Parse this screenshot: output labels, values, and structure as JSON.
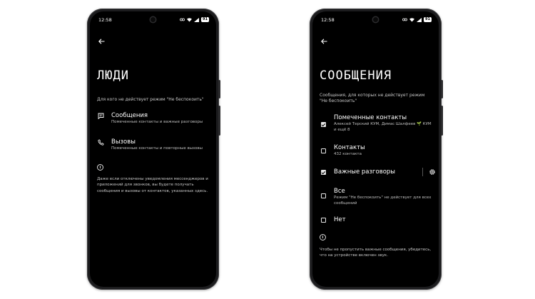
{
  "left_phone": {
    "status": {
      "time": "12:58",
      "battery": "91"
    },
    "title": "ЛЮДИ",
    "subtitle": "Для кого не действует режим \"Не беспокоить\"",
    "items": [
      {
        "title": "Сообщения",
        "subtitle": "Помеченные контакты и важные разговоры",
        "icon": "message-icon"
      },
      {
        "title": "Вызовы",
        "subtitle": "Помеченные контакты и повторные вызовы",
        "icon": "phone-icon"
      }
    ],
    "note": "Даже если отключены уведомления мессенджеров и приложений для звонков, вы будете получать сообщения и вызовы от контактов, указанных здесь."
  },
  "right_phone": {
    "status": {
      "time": "12:58",
      "battery": "91"
    },
    "title": "СООБЩЕНИЯ",
    "subtitle": "Сообщения, для которых не действует режим \"Не беспокоить\"",
    "options": [
      {
        "title": "Помеченные контакты",
        "subtitle": "Алексей Терский КУМ, Димас Шалфеев 🌱 КУМ и ещё 8",
        "checked": true
      },
      {
        "title": "Контакты",
        "subtitle": "432 контакта",
        "checked": false
      },
      {
        "title": "Важные разговоры",
        "subtitle": "",
        "checked": true,
        "has_settings": true
      },
      {
        "title": "Все",
        "subtitle": "Режим \"Не беспокоить\" не действует для всех сообщений",
        "checked": false
      },
      {
        "title": "Нет",
        "subtitle": "",
        "checked": false
      }
    ],
    "note": "Чтобы не пропустить важные сообщения, убедитесь, что на устройстве включен звук."
  }
}
